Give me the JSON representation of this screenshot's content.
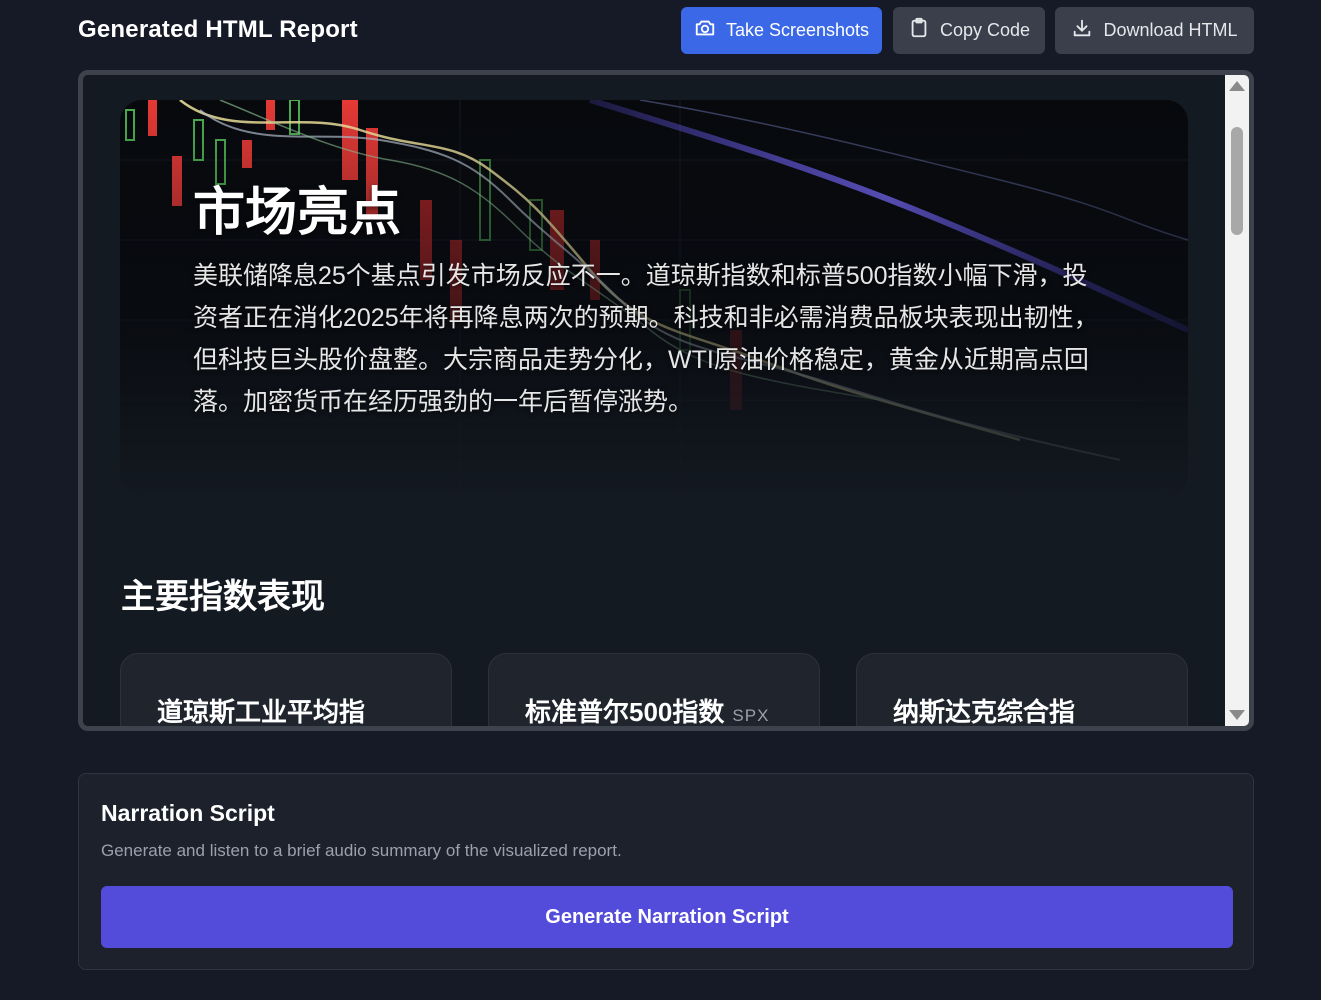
{
  "header": {
    "title": "Generated HTML Report",
    "screenshot_label": "Take Screenshots",
    "copy_label": "Copy Code",
    "download_label": "Download HTML"
  },
  "report": {
    "hero": {
      "title": "市场亮点",
      "body": "美联储降息25个基点引发市场反应不一。道琼斯指数和标普500指数小幅下滑，投资者正在消化2025年将再降息两次的预期。科技和非必需消费品板块表现出韧性，但科技巨头股价盘整。大宗商品走势分化，WTI原油价格稳定，黄金从近期高点回落。加密货币在经历强劲的一年后暂停涨势。"
    },
    "section_title": "主要指数表现",
    "cards": [
      {
        "title": "道琼斯工业平均指",
        "ticker": ""
      },
      {
        "title": "标准普尔500指数",
        "ticker": "SPX"
      },
      {
        "title": "纳斯达克综合指",
        "ticker": ""
      }
    ]
  },
  "narration": {
    "title": "Narration Script",
    "description": "Generate and listen to a brief audio summary of the visualized report.",
    "button_label": "Generate Narration Script"
  },
  "colors": {
    "page_bg": "#161a27",
    "primary_button": "#3b68e6",
    "narration_button": "#534bd9",
    "candle_up": "#4caf50",
    "candle_down": "#e53935"
  },
  "icons": {
    "screenshot": "camera-icon",
    "copy": "clipboard-icon",
    "download": "download-icon"
  }
}
